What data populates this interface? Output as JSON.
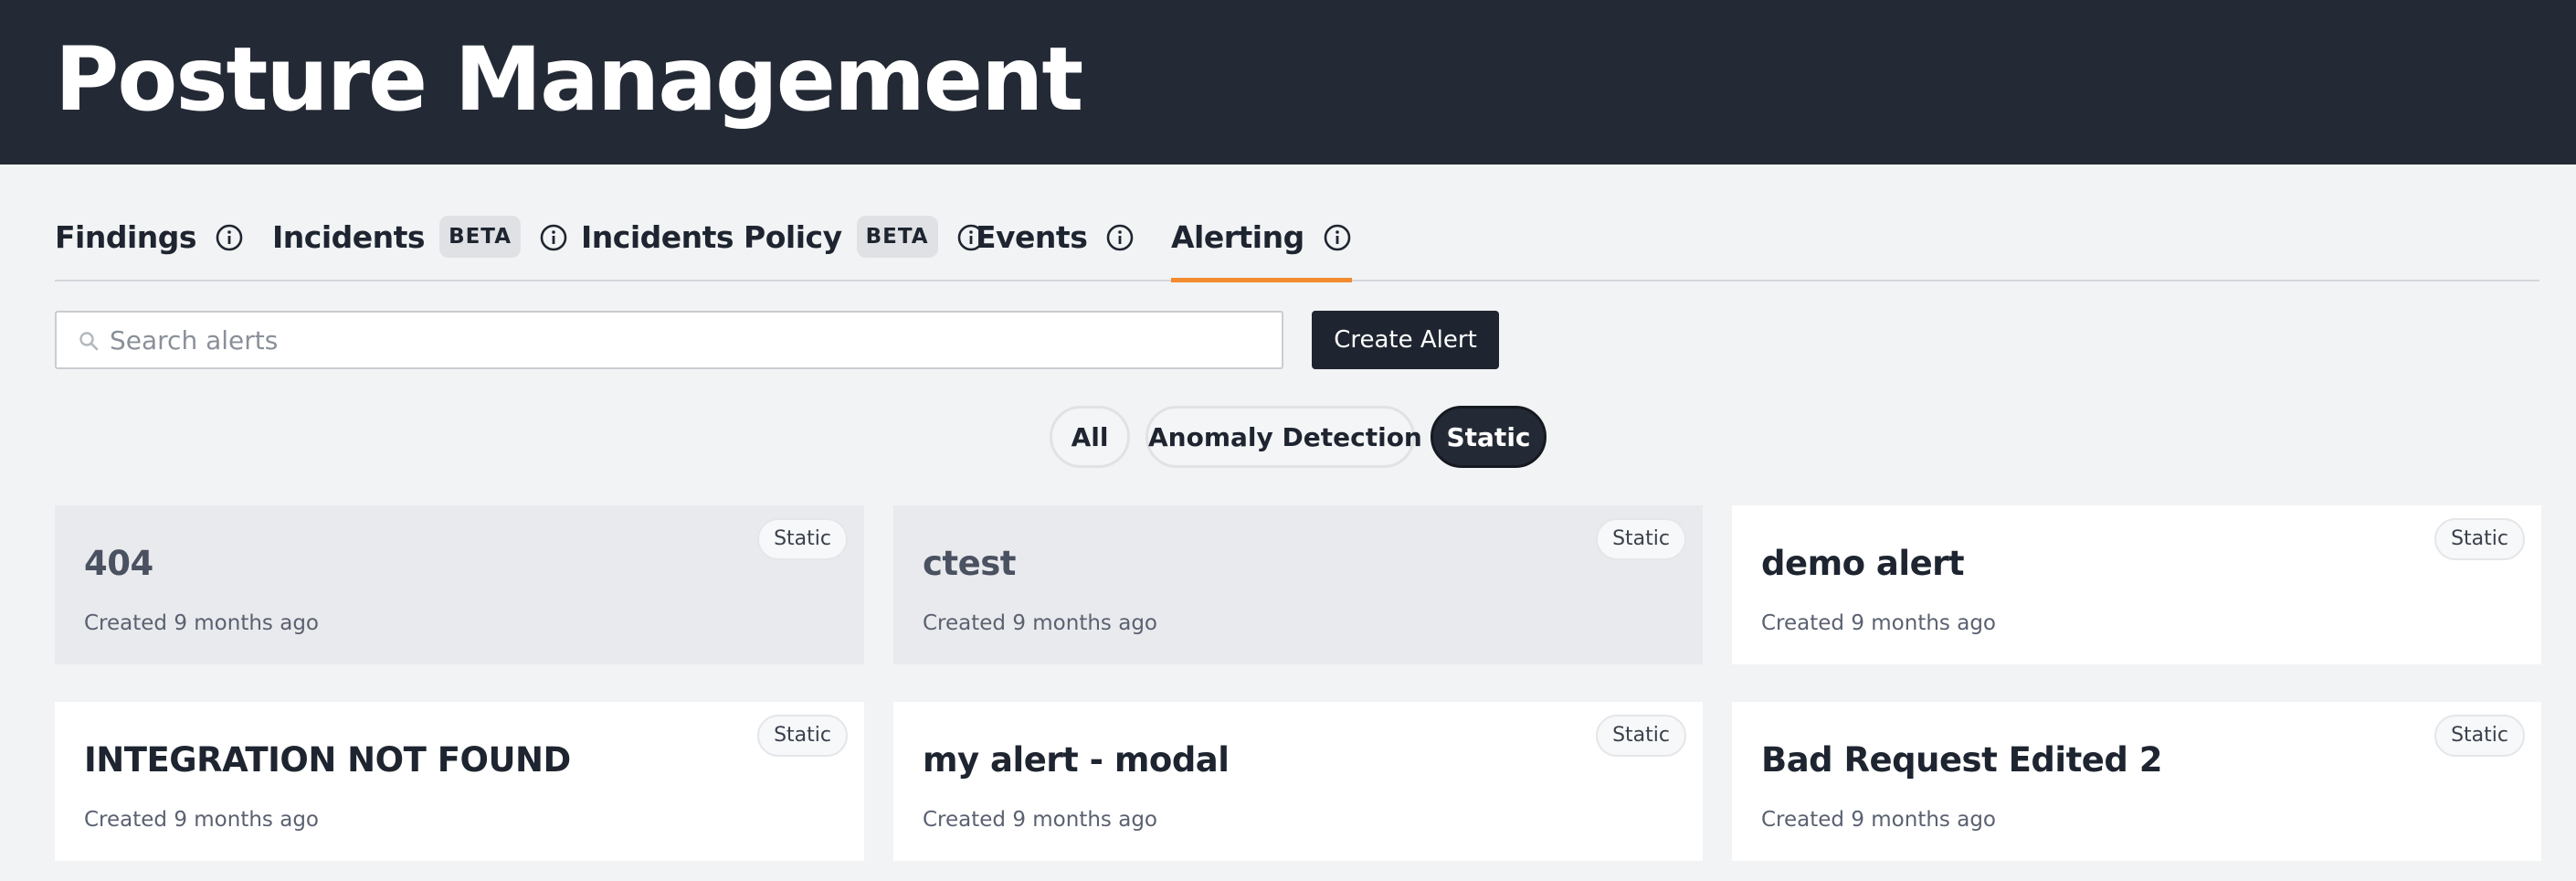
{
  "header": {
    "title": "Posture Management"
  },
  "tabs": [
    {
      "label": "Findings",
      "badge": ""
    },
    {
      "label": "Incidents",
      "badge": "BETA"
    },
    {
      "label": "Incidents Policy",
      "badge": "BETA"
    },
    {
      "label": "Events",
      "badge": ""
    },
    {
      "label": "Alerting",
      "badge": ""
    }
  ],
  "active_tab": "Alerting",
  "search": {
    "placeholder": "Search alerts",
    "value": ""
  },
  "toolbar": {
    "create_label": "Create Alert"
  },
  "filters": [
    {
      "label": "All"
    },
    {
      "label": "Anomaly Detection"
    },
    {
      "label": "Static"
    }
  ],
  "selected_filter": "Static",
  "alerts": [
    {
      "name": "404",
      "created": "Created 9 months ago",
      "type": "Static"
    },
    {
      "name": "ctest",
      "created": "Created 9 months ago",
      "type": "Static"
    },
    {
      "name": "demo alert",
      "created": "Created 9 months ago",
      "type": "Static"
    },
    {
      "name": "INTEGRATION NOT FOUND",
      "created": "Created 9 months ago",
      "type": "Static"
    },
    {
      "name": "my alert - modal",
      "created": "Created 9 months ago",
      "type": "Static"
    },
    {
      "name": "Bad Request Edited 2",
      "created": "Created 9 months ago",
      "type": "Static"
    }
  ],
  "colors": {
    "header_bg": "#242a35",
    "accent": "#f28a2e",
    "primary_button": "#1e2530",
    "page_bg": "#f2f3f5"
  }
}
